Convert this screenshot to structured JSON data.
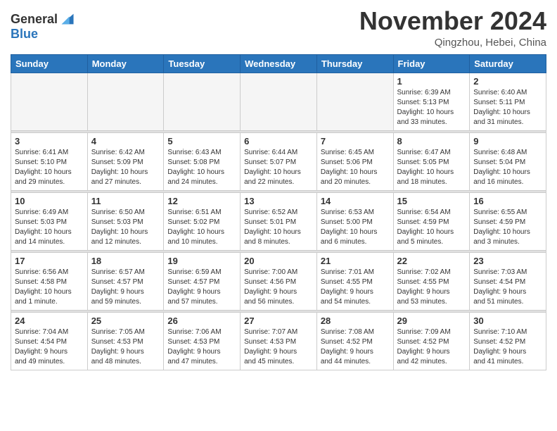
{
  "header": {
    "logo_general": "General",
    "logo_blue": "Blue",
    "month_year": "November 2024",
    "location": "Qingzhou, Hebei, China"
  },
  "weekdays": [
    "Sunday",
    "Monday",
    "Tuesday",
    "Wednesday",
    "Thursday",
    "Friday",
    "Saturday"
  ],
  "weeks": [
    [
      {
        "day": "",
        "info": ""
      },
      {
        "day": "",
        "info": ""
      },
      {
        "day": "",
        "info": ""
      },
      {
        "day": "",
        "info": ""
      },
      {
        "day": "",
        "info": ""
      },
      {
        "day": "1",
        "info": "Sunrise: 6:39 AM\nSunset: 5:13 PM\nDaylight: 10 hours\nand 33 minutes."
      },
      {
        "day": "2",
        "info": "Sunrise: 6:40 AM\nSunset: 5:11 PM\nDaylight: 10 hours\nand 31 minutes."
      }
    ],
    [
      {
        "day": "3",
        "info": "Sunrise: 6:41 AM\nSunset: 5:10 PM\nDaylight: 10 hours\nand 29 minutes."
      },
      {
        "day": "4",
        "info": "Sunrise: 6:42 AM\nSunset: 5:09 PM\nDaylight: 10 hours\nand 27 minutes."
      },
      {
        "day": "5",
        "info": "Sunrise: 6:43 AM\nSunset: 5:08 PM\nDaylight: 10 hours\nand 24 minutes."
      },
      {
        "day": "6",
        "info": "Sunrise: 6:44 AM\nSunset: 5:07 PM\nDaylight: 10 hours\nand 22 minutes."
      },
      {
        "day": "7",
        "info": "Sunrise: 6:45 AM\nSunset: 5:06 PM\nDaylight: 10 hours\nand 20 minutes."
      },
      {
        "day": "8",
        "info": "Sunrise: 6:47 AM\nSunset: 5:05 PM\nDaylight: 10 hours\nand 18 minutes."
      },
      {
        "day": "9",
        "info": "Sunrise: 6:48 AM\nSunset: 5:04 PM\nDaylight: 10 hours\nand 16 minutes."
      }
    ],
    [
      {
        "day": "10",
        "info": "Sunrise: 6:49 AM\nSunset: 5:03 PM\nDaylight: 10 hours\nand 14 minutes."
      },
      {
        "day": "11",
        "info": "Sunrise: 6:50 AM\nSunset: 5:03 PM\nDaylight: 10 hours\nand 12 minutes."
      },
      {
        "day": "12",
        "info": "Sunrise: 6:51 AM\nSunset: 5:02 PM\nDaylight: 10 hours\nand 10 minutes."
      },
      {
        "day": "13",
        "info": "Sunrise: 6:52 AM\nSunset: 5:01 PM\nDaylight: 10 hours\nand 8 minutes."
      },
      {
        "day": "14",
        "info": "Sunrise: 6:53 AM\nSunset: 5:00 PM\nDaylight: 10 hours\nand 6 minutes."
      },
      {
        "day": "15",
        "info": "Sunrise: 6:54 AM\nSunset: 4:59 PM\nDaylight: 10 hours\nand 5 minutes."
      },
      {
        "day": "16",
        "info": "Sunrise: 6:55 AM\nSunset: 4:59 PM\nDaylight: 10 hours\nand 3 minutes."
      }
    ],
    [
      {
        "day": "17",
        "info": "Sunrise: 6:56 AM\nSunset: 4:58 PM\nDaylight: 10 hours\nand 1 minute."
      },
      {
        "day": "18",
        "info": "Sunrise: 6:57 AM\nSunset: 4:57 PM\nDaylight: 9 hours\nand 59 minutes."
      },
      {
        "day": "19",
        "info": "Sunrise: 6:59 AM\nSunset: 4:57 PM\nDaylight: 9 hours\nand 57 minutes."
      },
      {
        "day": "20",
        "info": "Sunrise: 7:00 AM\nSunset: 4:56 PM\nDaylight: 9 hours\nand 56 minutes."
      },
      {
        "day": "21",
        "info": "Sunrise: 7:01 AM\nSunset: 4:55 PM\nDaylight: 9 hours\nand 54 minutes."
      },
      {
        "day": "22",
        "info": "Sunrise: 7:02 AM\nSunset: 4:55 PM\nDaylight: 9 hours\nand 53 minutes."
      },
      {
        "day": "23",
        "info": "Sunrise: 7:03 AM\nSunset: 4:54 PM\nDaylight: 9 hours\nand 51 minutes."
      }
    ],
    [
      {
        "day": "24",
        "info": "Sunrise: 7:04 AM\nSunset: 4:54 PM\nDaylight: 9 hours\nand 49 minutes."
      },
      {
        "day": "25",
        "info": "Sunrise: 7:05 AM\nSunset: 4:53 PM\nDaylight: 9 hours\nand 48 minutes."
      },
      {
        "day": "26",
        "info": "Sunrise: 7:06 AM\nSunset: 4:53 PM\nDaylight: 9 hours\nand 47 minutes."
      },
      {
        "day": "27",
        "info": "Sunrise: 7:07 AM\nSunset: 4:53 PM\nDaylight: 9 hours\nand 45 minutes."
      },
      {
        "day": "28",
        "info": "Sunrise: 7:08 AM\nSunset: 4:52 PM\nDaylight: 9 hours\nand 44 minutes."
      },
      {
        "day": "29",
        "info": "Sunrise: 7:09 AM\nSunset: 4:52 PM\nDaylight: 9 hours\nand 42 minutes."
      },
      {
        "day": "30",
        "info": "Sunrise: 7:10 AM\nSunset: 4:52 PM\nDaylight: 9 hours\nand 41 minutes."
      }
    ]
  ]
}
